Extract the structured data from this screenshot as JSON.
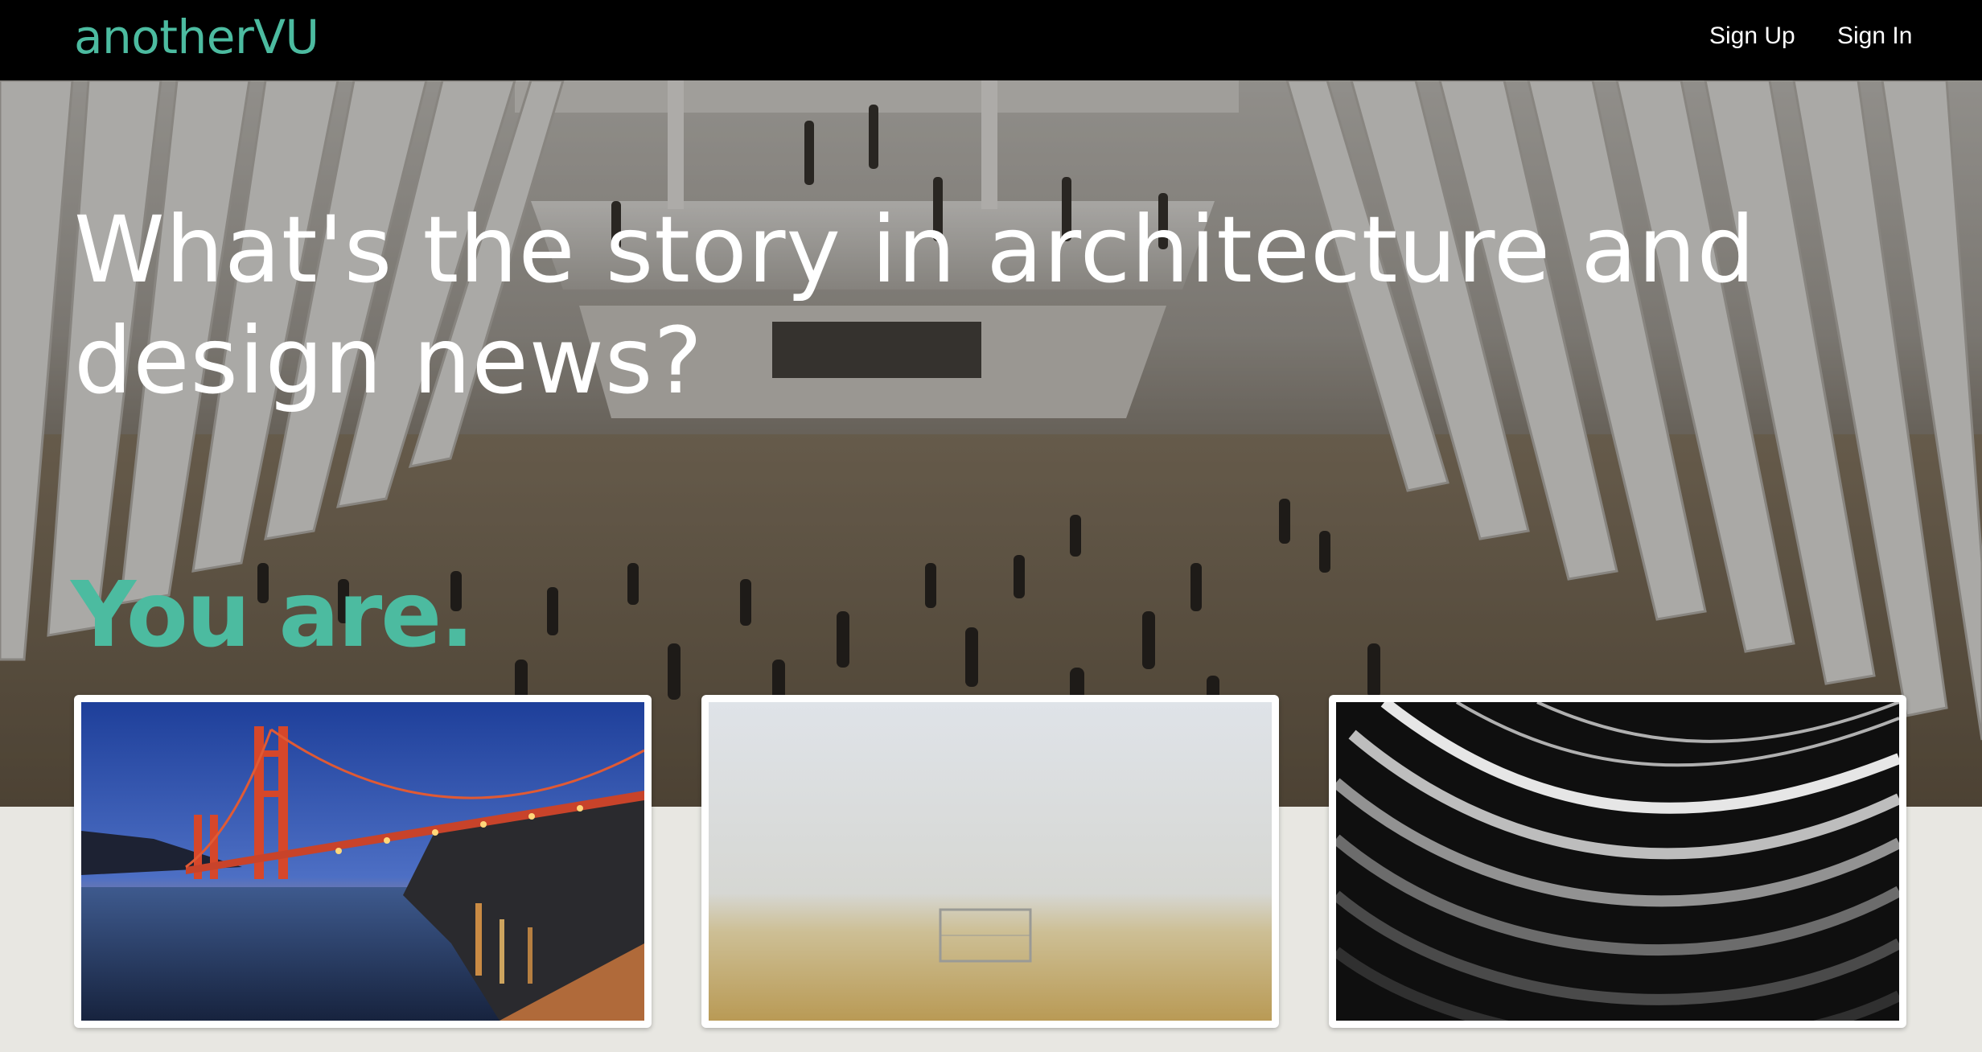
{
  "nav": {
    "logo": "anotherVU",
    "sign_up": "Sign Up",
    "sign_in": "Sign In"
  },
  "hero": {
    "headline": "What's the story in architecture and design news?",
    "tagline": "You are."
  },
  "colors": {
    "accent": "#4cbba0",
    "nav_background": "#000000",
    "page_background": "#e8e7e2"
  },
  "cards": [
    {
      "name": "golden-gate-bridge-photo"
    },
    {
      "name": "foggy-field-goal-photo"
    },
    {
      "name": "curved-facade-photo"
    }
  ]
}
